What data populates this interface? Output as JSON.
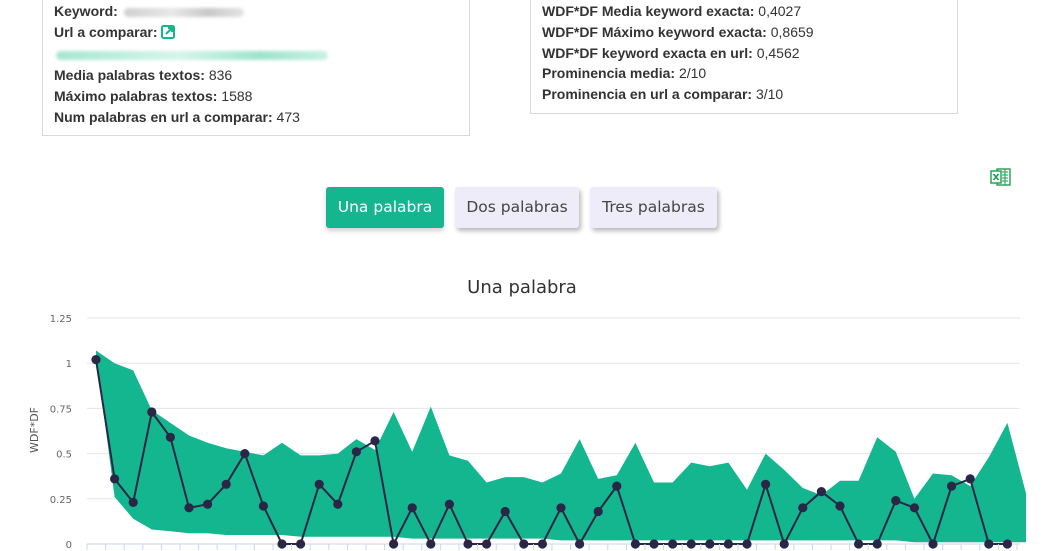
{
  "stats_left": {
    "keyword_label": "Keyword:",
    "url_label": "Url a comparar:",
    "media_label": "Media palabras textos:",
    "media_value": "836",
    "max_label": "Máximo palabras textos:",
    "max_value": "1588",
    "num_label": "Num palabras en url a comparar:",
    "num_value": "473"
  },
  "stats_right": {
    "wdf_media_label": "WDF*DF Media keyword exacta:",
    "wdf_media_value": "0,4027",
    "wdf_max_label": "WDF*DF Máximo keyword exacta:",
    "wdf_max_value": "0,8659",
    "wdf_url_label": "WDF*DF keyword exacta en url:",
    "wdf_url_value": "0,4562",
    "prom_media_label": "Prominencia media:",
    "prom_media_value": "2/10",
    "prom_url_label": "Prominencia en url a comparar:",
    "prom_url_value": "3/10"
  },
  "tabs": [
    {
      "label": "Una palabra",
      "active": true
    },
    {
      "label": "Dos palabras",
      "active": false
    },
    {
      "label": "Tres palabras",
      "active": false
    }
  ],
  "colors": {
    "accent": "#14b690",
    "area": "#14b690",
    "line": "#2a2645",
    "tab_inactive": "#eeecf8",
    "excel": "#1e9e4e"
  },
  "icons": {
    "external_link": "external-link-icon",
    "export": "excel-export-icon"
  },
  "chart_data": {
    "type": "area",
    "title": "Una palabra",
    "ylabel": "WDF*DF",
    "xlabel": "",
    "ylim": [
      0,
      1.25
    ],
    "yticks": [
      "0",
      "0.25",
      "0.5",
      "0.75",
      "1",
      "1.25"
    ],
    "grid": true,
    "series": [
      {
        "type": "area",
        "values": [
          1.07,
          1.0,
          0.96,
          0.74,
          0.67,
          0.6,
          0.56,
          0.53,
          0.51,
          0.49,
          0.56,
          0.49,
          0.49,
          0.5,
          0.58,
          0.52,
          0.73,
          0.51,
          0.76,
          0.49,
          0.46,
          0.34,
          0.37,
          0.37,
          0.34,
          0.39,
          0.58,
          0.36,
          0.38,
          0.56,
          0.34,
          0.34,
          0.45,
          0.43,
          0.45,
          0.3,
          0.5,
          0.41,
          0.31,
          0.27,
          0.35,
          0.35,
          0.59,
          0.51,
          0.25,
          0.39,
          0.38,
          0.32,
          0.48,
          0.67,
          0.28
        ],
        "lower": [
          1.05,
          0.26,
          0.14,
          0.08,
          0.07,
          0.06,
          0.06,
          0.05,
          0.05,
          0.05,
          0.05,
          0.04,
          0.04,
          0.04,
          0.04,
          0.04,
          0.04,
          0.03,
          0.03,
          0.03,
          0.03,
          0.03,
          0.03,
          0.03,
          0.03,
          0.02,
          0.02,
          0.02,
          0.02,
          0.02,
          0.02,
          0.02,
          0.02,
          0.02,
          0.02,
          0.02,
          0.02,
          0.02,
          0.02,
          0.02,
          0.02,
          0.02,
          0.02,
          0.02,
          0.01,
          0.01,
          0.01,
          0.01,
          0.01,
          0.01,
          0.01
        ]
      },
      {
        "type": "line",
        "values": [
          1.02,
          0.36,
          0.23,
          0.73,
          0.59,
          0.2,
          0.22,
          0.33,
          0.5,
          0.21,
          0.0,
          0.0,
          0.33,
          0.22,
          0.51,
          0.57,
          0.0,
          0.2,
          0.0,
          0.22,
          0.0,
          0.0,
          0.18,
          0.0,
          0.0,
          0.2,
          0.0,
          0.18,
          0.32,
          0.0,
          0.0,
          0.0,
          0.0,
          0.0,
          0.0,
          0.0,
          0.33,
          0.0,
          0.2,
          0.29,
          0.21,
          0.0,
          0.0,
          0.24,
          0.2,
          0.0,
          0.32,
          0.36,
          0.0,
          0.0
        ]
      }
    ]
  }
}
